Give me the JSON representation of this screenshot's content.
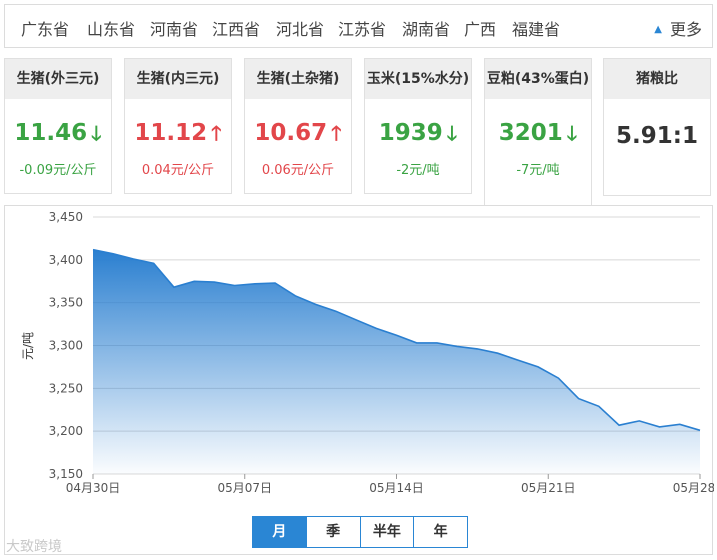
{
  "provinces": [
    "广东省",
    "山东省",
    "河南省",
    "江西省",
    "河北省",
    "江苏省",
    "湖南省",
    "广西",
    "福建省"
  ],
  "more_label": "更多",
  "cards": [
    {
      "title": "生猪(外三元)",
      "price": "11.46",
      "dir": "down",
      "change": "-0.09元/公斤"
    },
    {
      "title": "生猪(内三元)",
      "price": "11.12",
      "dir": "up",
      "change": "0.04元/公斤"
    },
    {
      "title": "生猪(土杂猪)",
      "price": "10.67",
      "dir": "up",
      "change": "0.06元/公斤"
    },
    {
      "title": "玉米(15%水分)",
      "price": "1939",
      "dir": "down",
      "change": "-2元/吨"
    },
    {
      "title": "豆粕(43%蛋白)",
      "price": "3201",
      "dir": "down",
      "change": "-7元/吨"
    }
  ],
  "ratio_card": {
    "title": "猪粮比",
    "value": "5.91:1"
  },
  "colors": {
    "up": "#e2464a",
    "down": "#3aa343",
    "accent": "#2a86d4"
  },
  "chart_data": {
    "type": "area",
    "ylabel": "元/吨",
    "ylim": [
      3150,
      3450
    ],
    "yticks": [
      3150,
      3200,
      3250,
      3300,
      3350,
      3400,
      3450
    ],
    "ytick_labels": [
      "3,150",
      "3,200",
      "3,250",
      "3,300",
      "3,350",
      "3,400",
      "3,450"
    ],
    "x_start": "04月30日",
    "x_end": "05月28日",
    "xtick_labels": [
      "04月30日",
      "05月07日",
      "05月14日",
      "05月21日",
      "05月28日"
    ],
    "dates": [
      "04月30日",
      "05月01日",
      "05月02日",
      "05月03日",
      "05月04日",
      "05月05日",
      "05月06日",
      "05月07日",
      "05月08日",
      "05月09日",
      "05月10日",
      "05月11日",
      "05月12日",
      "05月13日",
      "05月14日",
      "05月15日",
      "05月16日",
      "05月17日",
      "05月18日",
      "05月19日",
      "05月20日",
      "05月21日",
      "05月22日",
      "05月23日",
      "05月24日",
      "05月25日",
      "05月26日",
      "05月27日",
      "05月28日"
    ],
    "values": [
      3412,
      3407,
      3401,
      3396,
      3368,
      3375,
      3374,
      3370,
      3372,
      3373,
      3358,
      3348,
      3340,
      3330,
      3320,
      3312,
      3303,
      3303,
      3299,
      3296,
      3291,
      3283,
      3275,
      3262,
      3238,
      3229,
      3207,
      3212,
      3205,
      3208,
      3201
    ],
    "grid": true
  },
  "period_tabs": [
    "月",
    "季",
    "半年",
    "年"
  ],
  "selected_period": "月",
  "watermark": "大致跨境"
}
